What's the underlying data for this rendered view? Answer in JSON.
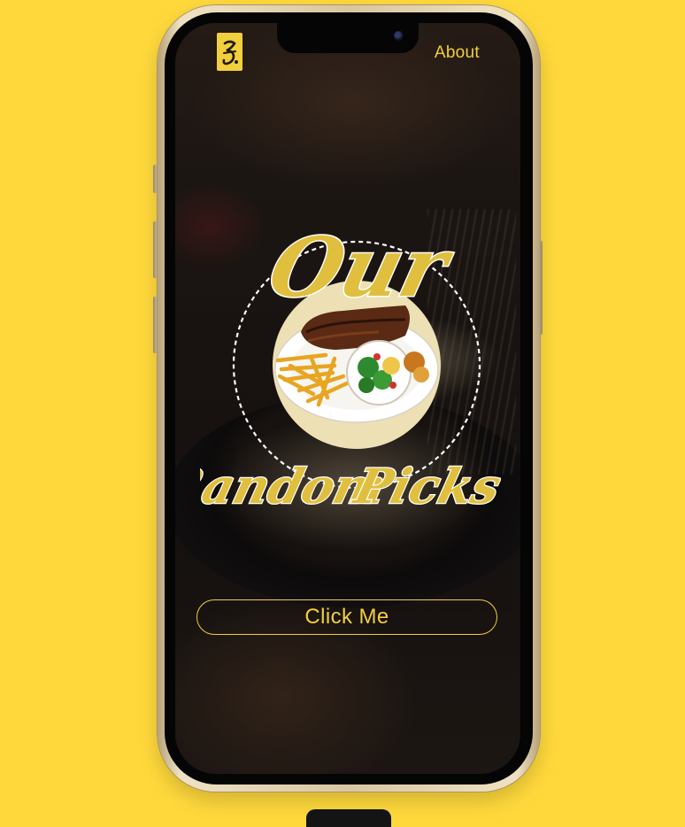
{
  "header": {
    "logo_text": "ℨ.",
    "about_label": "About"
  },
  "hero": {
    "title_top": "Our",
    "title_left": "Random",
    "title_right": "Picks",
    "image": "steak-fries-salad-plate"
  },
  "cta": {
    "label": "Click Me"
  },
  "colors": {
    "page_background": "#ffd93c",
    "accent": "#f2cf3d",
    "title_fill": "#e0bf3e",
    "screen_overlay": "#141110"
  },
  "icons": {
    "logo": "brand-monogram-icon",
    "camera": "front-camera-icon"
  }
}
